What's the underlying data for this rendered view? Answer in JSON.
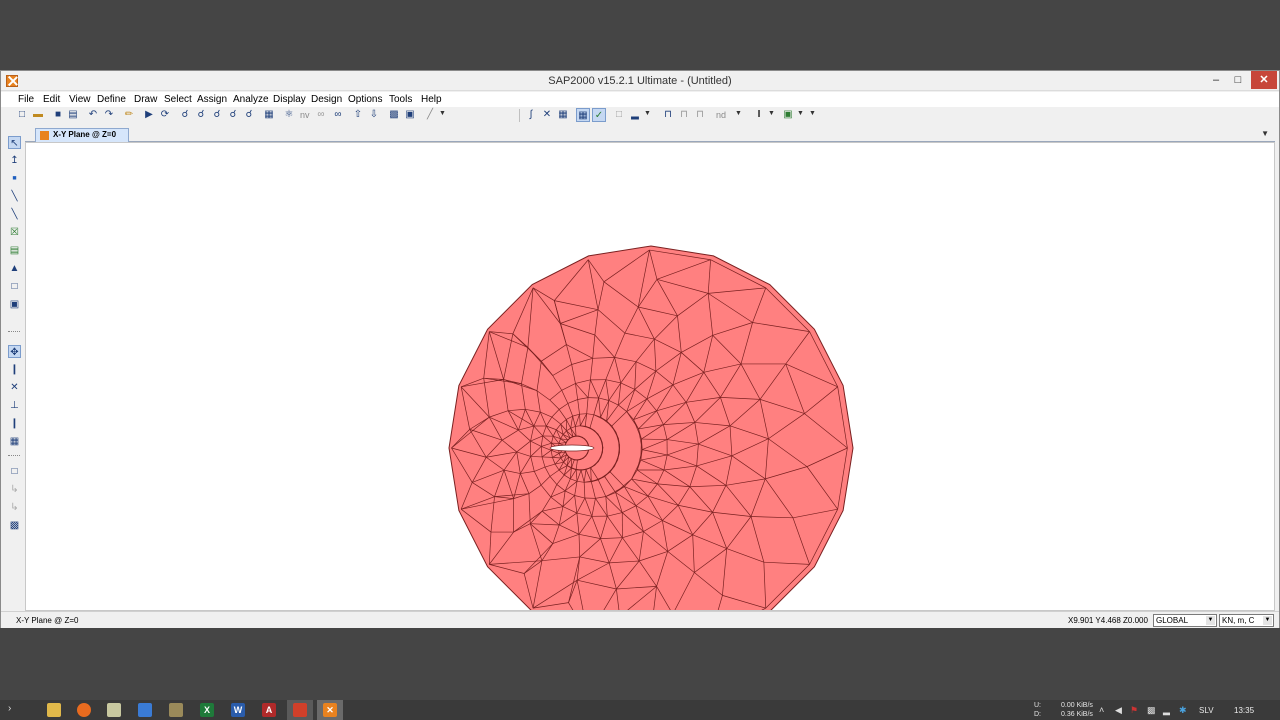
{
  "window": {
    "title": "SAP2000 v15.2.1 Ultimate  - (Untitled)"
  },
  "menu": [
    "File",
    "Edit",
    "View",
    "Define",
    "Draw",
    "Select",
    "Assign",
    "Analyze",
    "Display",
    "Design",
    "Options",
    "Tools",
    "Help"
  ],
  "toolbar": {
    "nv_label": "nv",
    "nd_label": "nd"
  },
  "tab": {
    "label": "X-Y Plane @ Z=0"
  },
  "model": {
    "fill_color": "#ff8080",
    "line_color": "#7a2020"
  },
  "status": {
    "view": "X-Y Plane @ Z=0",
    "coords": "X9.901  Y4.468  Z0.000",
    "coord_system": "GLOBAL",
    "units": "KN, m, C"
  },
  "taskbar": {
    "net_up_label": "U:",
    "net_up": "0.00 KiB/s",
    "net_down_label": "D:",
    "net_down": "0.36 KiB/s",
    "lang": "SLV",
    "time": "13:35"
  }
}
